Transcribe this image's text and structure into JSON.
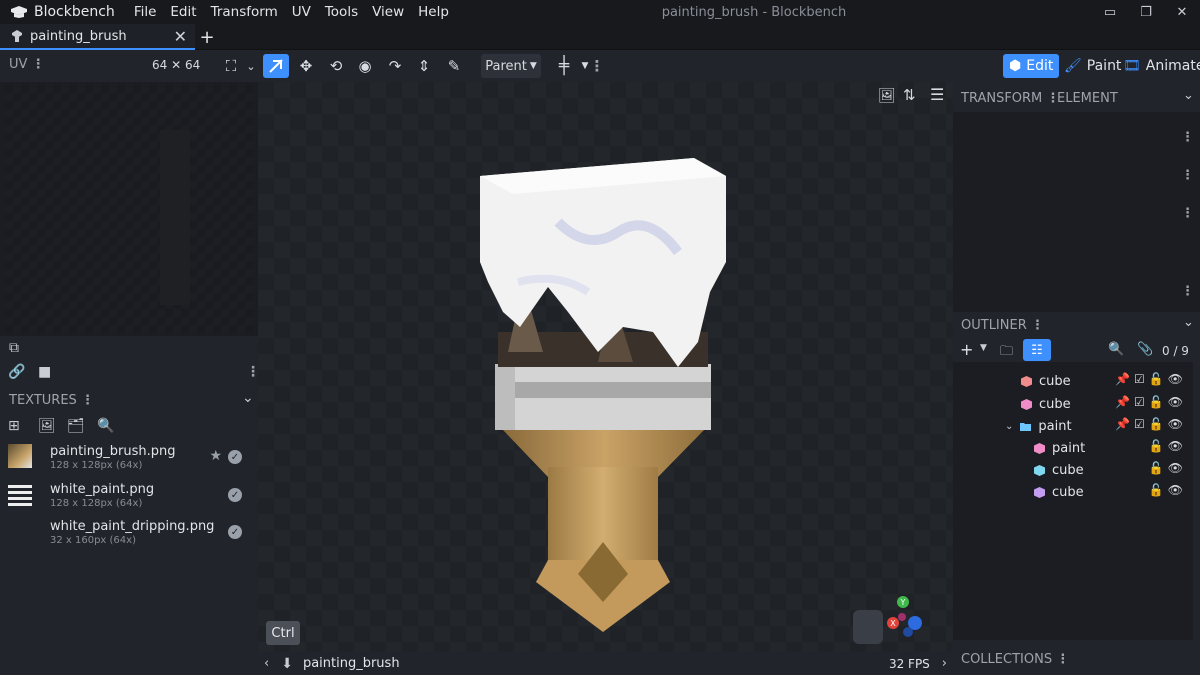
{
  "titlebar": {
    "app_name": "Blockbench",
    "menu": [
      "File",
      "Edit",
      "Transform",
      "UV",
      "Tools",
      "View",
      "Help"
    ],
    "window_title": "painting_brush - Blockbench"
  },
  "tab": {
    "label": "painting_brush"
  },
  "toolbar": {
    "uv_label": "UV",
    "uv_size": "64 ✕ 64",
    "pivot_mode": "Parent",
    "modes": [
      "Edit",
      "Paint",
      "Animate"
    ]
  },
  "textures": {
    "header": "TEXTURES",
    "items": [
      {
        "name": "painting_brush.png",
        "meta": "128 x 128px (64x)"
      },
      {
        "name": "white_paint.png",
        "meta": "128 x 128px (64x)"
      },
      {
        "name": "white_paint_dripping.png",
        "meta": "32 x 160px (64x)"
      }
    ]
  },
  "viewport": {
    "ctrl_label": "Ctrl",
    "model_name": "painting_brush",
    "fps": "32 FPS",
    "gizmo": {
      "x": "X",
      "y": "Y"
    }
  },
  "right": {
    "transform_tab": "TRANSFORM",
    "element_tab": "ELEMENT",
    "outliner_header": "OUTLINER",
    "counter": "0 / 9",
    "rows": [
      {
        "label": "cube",
        "color": "#f08c8c"
      },
      {
        "label": "cube",
        "color": "#f08cc8"
      },
      {
        "label": "paint",
        "color": "#6ec6ff"
      },
      {
        "label": "paint",
        "color": "#f08cc8"
      },
      {
        "label": "cube",
        "color": "#7fd8f0"
      },
      {
        "label": "cube",
        "color": "#c49cf0"
      }
    ],
    "collections_header": "COLLECTIONS"
  }
}
